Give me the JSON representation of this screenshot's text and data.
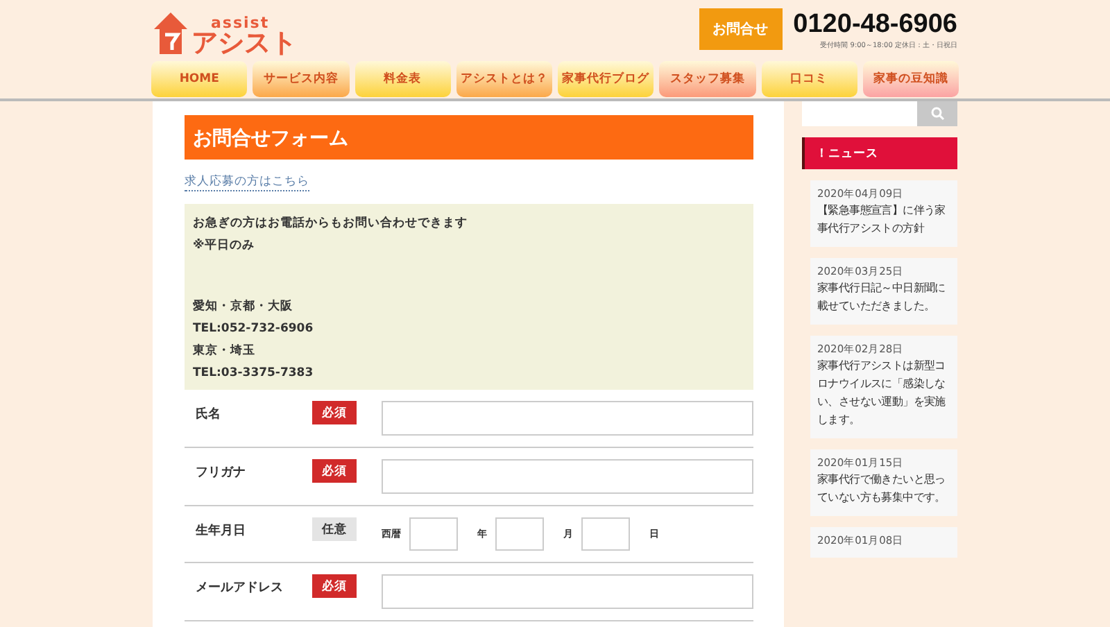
{
  "header": {
    "logo_small": "assist",
    "logo_main": "アシスト",
    "contact_button": "お問合せ",
    "phone": "0120-48-6906",
    "hours": "受付時間 9:00～18:00 定休日：土・日祝日"
  },
  "nav": [
    {
      "label": "HOME",
      "color": "#fdd23a"
    },
    {
      "label": "サービス内容",
      "color": "#fba84a"
    },
    {
      "label": "料金表",
      "color": "#fdd23a"
    },
    {
      "label": "アシストとは？",
      "color": "#fba84a"
    },
    {
      "label": "家事代行ブログ",
      "color": "#fdd23a"
    },
    {
      "label": "スタッフ募集",
      "color": "#fb9a7a"
    },
    {
      "label": "口コミ",
      "color": "#fdd23a"
    },
    {
      "label": "家事の豆知識",
      "color": "#fba3a3"
    }
  ],
  "form": {
    "title": "お問合せフォーム",
    "recruit_link": "求人応募の方はこちら",
    "notice": [
      [
        "お急ぎの方はお電話からもお問い合わせできます",
        "※平日のみ"
      ],
      [
        "愛知・京都・大阪",
        "TEL:052-732-6906",
        "東京・埼玉",
        "TEL:03-3375-7383"
      ]
    ],
    "rows": [
      {
        "label": "氏名",
        "badge": "必須",
        "required": true,
        "kind": "text"
      },
      {
        "label": "フリガナ",
        "badge": "必須",
        "required": true,
        "kind": "text"
      },
      {
        "label": "生年月日",
        "badge": "任意",
        "required": false,
        "kind": "date",
        "parts": [
          "西暦",
          "年",
          "月",
          "日"
        ]
      },
      {
        "label": "メールアドレス",
        "badge": "必須",
        "required": true,
        "kind": "text"
      }
    ]
  },
  "sidebar": {
    "news_title": "！ニュース",
    "news": [
      {
        "date": "2020年04月09日",
        "title": "【緊急事態宣言】に伴う家事代行アシストの方針"
      },
      {
        "date": "2020年03月25日",
        "title": "家事代行日記～中日新聞に載せていただきました。"
      },
      {
        "date": "2020年02月28日",
        "title": "家事代行アシストは新型コロナウイルスに「感染しない、させない運動」を実施します。"
      },
      {
        "date": "2020年01月15日",
        "title": "家事代行で働きたいと思っていない方も募集中です。"
      },
      {
        "date": "2020年01月08日"
      }
    ]
  }
}
